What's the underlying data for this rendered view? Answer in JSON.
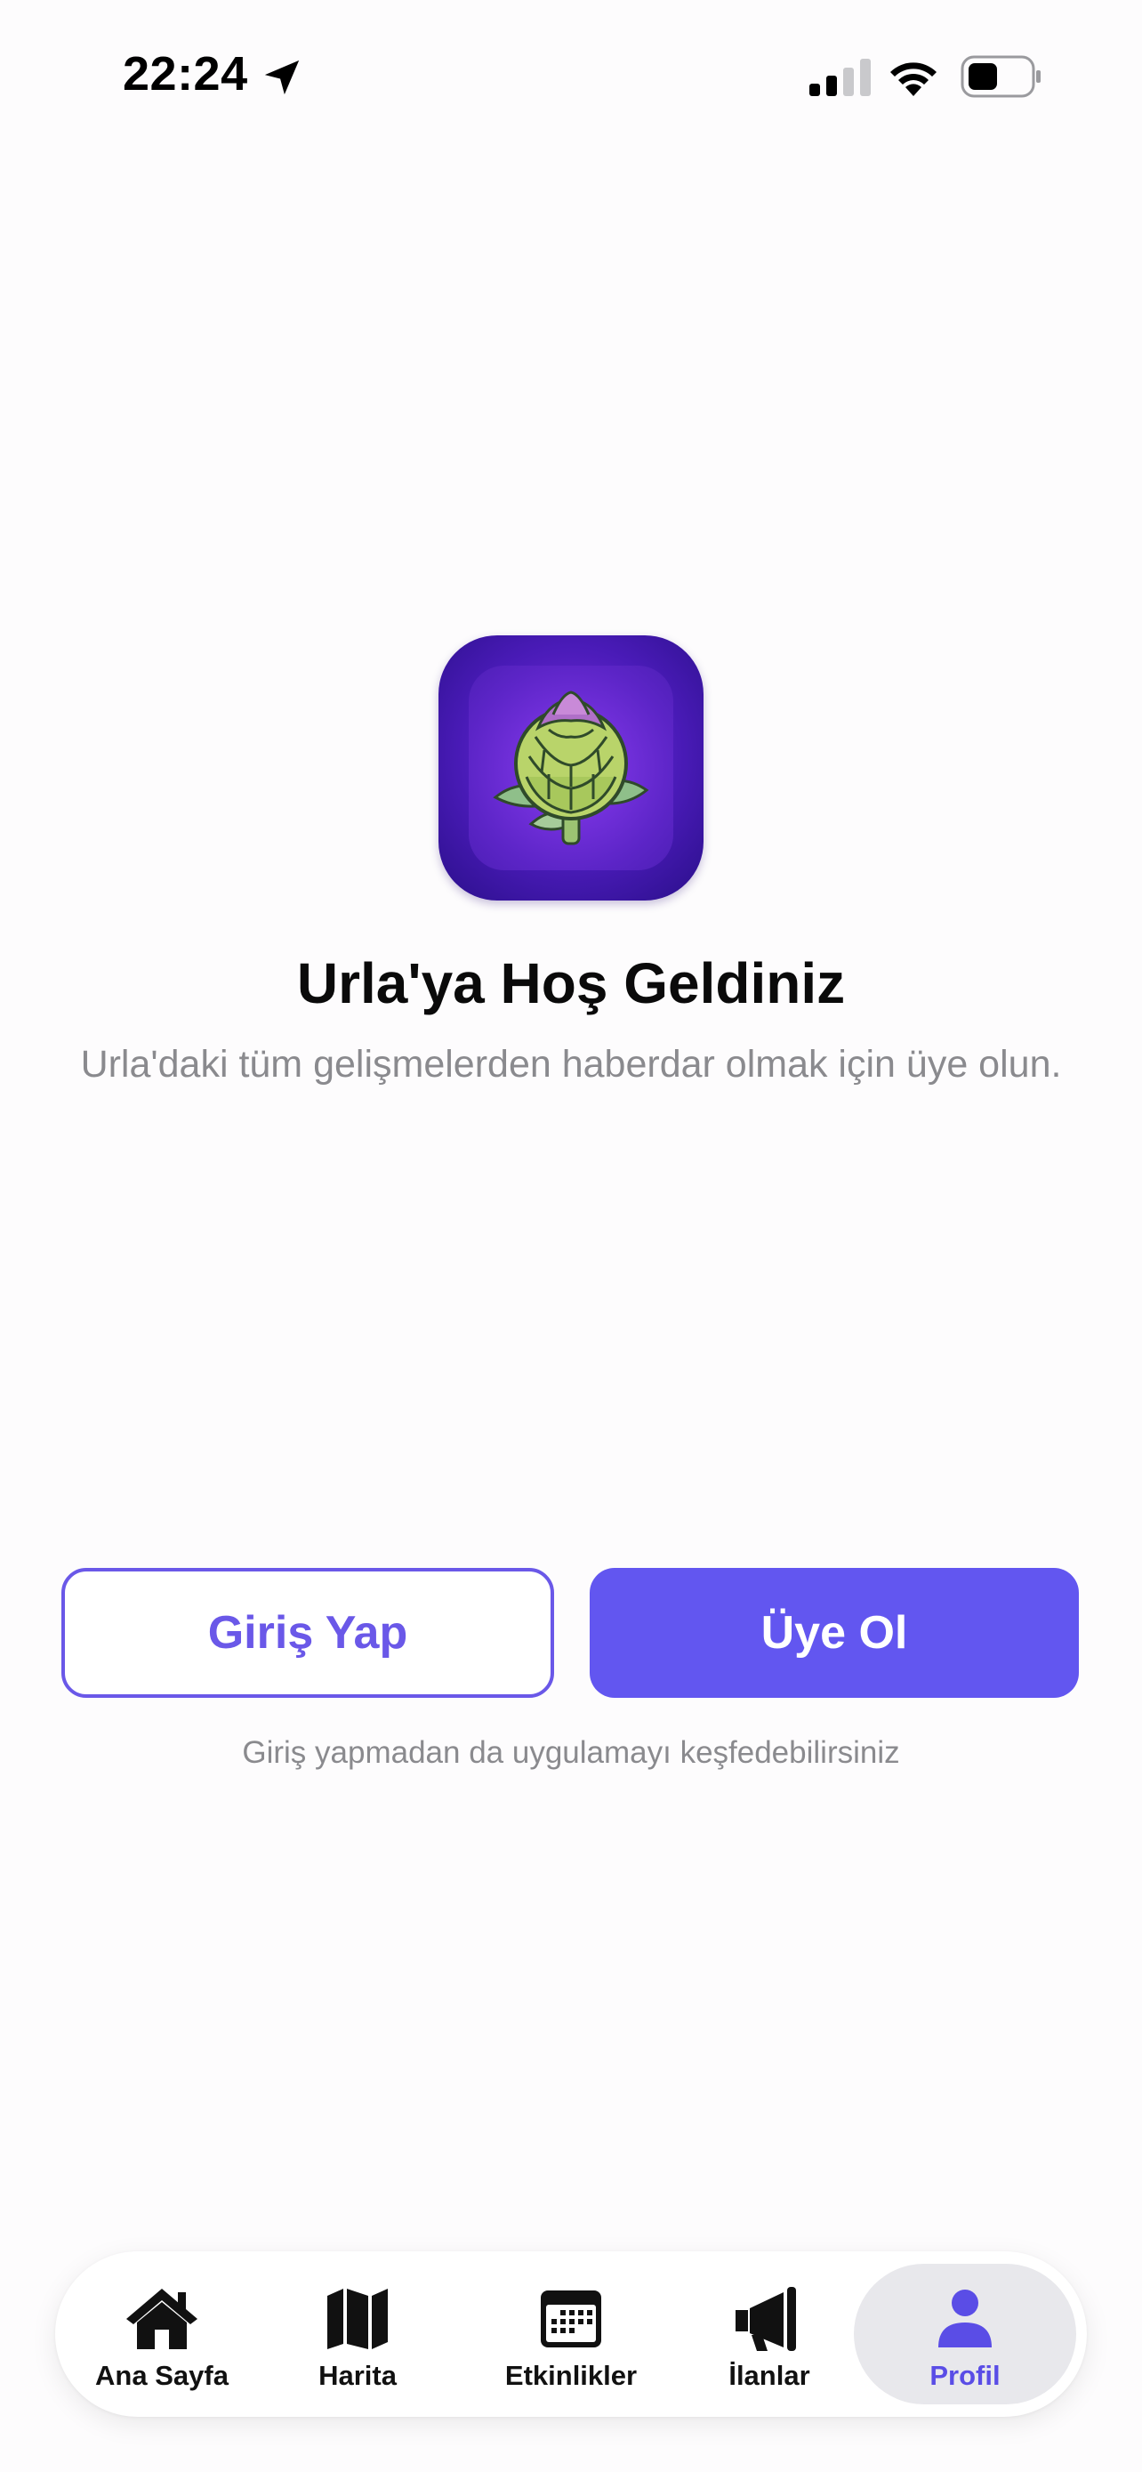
{
  "status_bar": {
    "time": "22:24",
    "icons": [
      "location-arrow-icon",
      "cellular-signal-icon",
      "wifi-icon",
      "battery-icon"
    ]
  },
  "welcome": {
    "logo_icon": "artichoke-icon",
    "title": "Urla'ya Hoş Geldiniz",
    "subtitle": "Urla'daki tüm gelişmelerden haberdar olmak için üye olun."
  },
  "actions": {
    "login_label": "Giriş Yap",
    "signup_label": "Üye Ol",
    "explore_note": "Giriş yapmadan da uygulamayı keşfedebilirsiniz"
  },
  "tab_bar": {
    "active": "Profil",
    "items": [
      {
        "label": "Ana Sayfa",
        "icon": "house-icon"
      },
      {
        "label": "Harita",
        "icon": "map-icon"
      },
      {
        "label": "Etkinlikler",
        "icon": "calendar-icon"
      },
      {
        "label": "İlanlar",
        "icon": "megaphone-icon"
      },
      {
        "label": "Profil",
        "icon": "person-icon"
      }
    ]
  },
  "colors": {
    "accent": "#6256f0",
    "accent_text": "#5a4de6",
    "muted_text": "#8a8a8e",
    "background": "#fdfcfd"
  }
}
